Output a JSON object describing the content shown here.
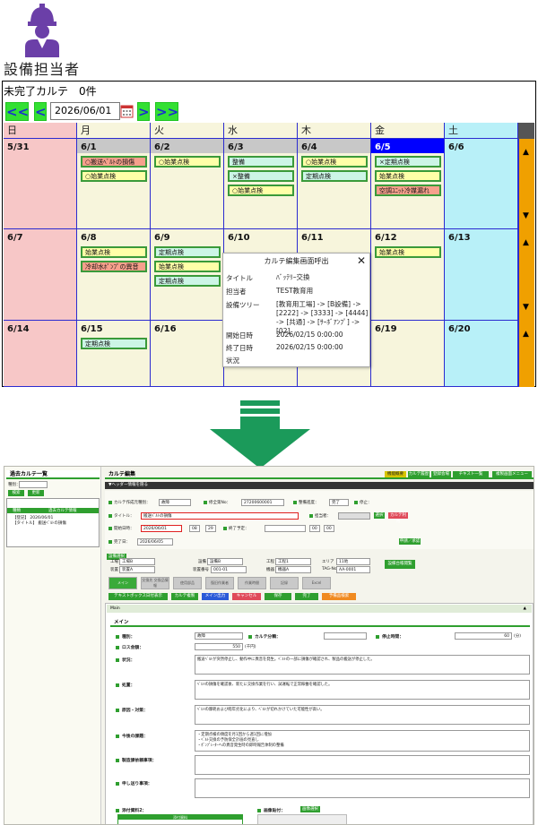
{
  "role": {
    "label": "設備担当者"
  },
  "calendar": {
    "title": "未完了カルテ　0件",
    "nav": {
      "first": "<<",
      "prev": "<",
      "next": ">",
      "last": ">>"
    },
    "date_value": "2026/06/01",
    "weekdays": [
      "日",
      "月",
      "火",
      "水",
      "木",
      "金",
      "土"
    ],
    "weeks": [
      {
        "days": [
          {
            "num": "5/31",
            "chips": []
          },
          {
            "num": "6/1",
            "chips": [
              {
                "text": "○搬送ﾍﾞﾙﾄの損傷",
                "kind": "r"
              },
              {
                "text": "○始業点検",
                "kind": "y"
              }
            ]
          },
          {
            "num": "6/2",
            "chips": [
              {
                "text": "○始業点検",
                "kind": "y"
              }
            ]
          },
          {
            "num": "6/3",
            "chips": [
              {
                "text": "整備",
                "kind": "c"
              },
              {
                "text": "×整備",
                "kind": "c"
              },
              {
                "text": "○始業点検",
                "kind": "y"
              }
            ]
          },
          {
            "num": "6/4",
            "chips": [
              {
                "text": "○始業点検",
                "kind": "y"
              },
              {
                "text": "定期点検",
                "kind": "c"
              }
            ]
          },
          {
            "num": "6/5",
            "chips": [
              {
                "text": "×定期点検",
                "kind": "c"
              },
              {
                "text": "始業点検",
                "kind": "y"
              },
              {
                "text": "空調ﾕﾆｯﾄ冷媒漏れ",
                "kind": "r"
              }
            ]
          },
          {
            "num": "6/6",
            "chips": []
          }
        ]
      },
      {
        "days": [
          {
            "num": "6/7",
            "chips": []
          },
          {
            "num": "6/8",
            "chips": [
              {
                "text": "始業点検",
                "kind": "y"
              },
              {
                "text": "冷却水ﾎﾟﾝﾌﾟの異音",
                "kind": "r"
              }
            ]
          },
          {
            "num": "6/9",
            "chips": [
              {
                "text": "定期点検",
                "kind": "c"
              },
              {
                "text": "始業点検",
                "kind": "y"
              },
              {
                "text": "定期点検",
                "kind": "c"
              }
            ]
          },
          {
            "num": "6/10",
            "chips": []
          },
          {
            "num": "6/11",
            "chips": []
          },
          {
            "num": "6/12",
            "chips": [
              {
                "text": "始業点検",
                "kind": "y"
              }
            ]
          },
          {
            "num": "6/13",
            "chips": []
          }
        ]
      },
      {
        "days": [
          {
            "num": "6/14",
            "chips": []
          },
          {
            "num": "6/15",
            "chips": [
              {
                "text": "定期点検",
                "kind": "c"
              }
            ]
          },
          {
            "num": "6/16",
            "chips": []
          },
          {
            "num": "",
            "chips": []
          },
          {
            "num": "",
            "chips": []
          },
          {
            "num": "6/19",
            "chips": []
          },
          {
            "num": "6/20",
            "chips": []
          }
        ]
      }
    ],
    "today_index": 5,
    "scroll": {
      "up": "▲",
      "down": "▼"
    }
  },
  "popup": {
    "title": "カルテ編集画面呼出",
    "close": "✕",
    "rows": [
      {
        "key": "タイトル",
        "value": "ﾊﾞｯﾃﾘｰ交換"
      },
      {
        "key": "担当者",
        "value": "TEST教育用"
      },
      {
        "key": "設備ツリー",
        "value": "[教育用工場] -> [B設備] -> [2222] -> [3333] -> [4444] -> [共通] -> [ｻｰﾎﾞｱﾝﾌﾟ] -> [02]"
      },
      {
        "key": "開始日時",
        "value": "2026/02/15 0:00:00"
      },
      {
        "key": "終了日時",
        "value": "2026/02/15 0:00:00"
      },
      {
        "key": "状況",
        "value": ""
      }
    ]
  },
  "editor": {
    "left_title": "過去カルテ一覧",
    "left_kind_label": "種別：",
    "left_btn1": "検索",
    "left_btn2": "更新",
    "left_col1": "種類",
    "left_col2": "過去カルテ情報",
    "left_row1": "【登記】 2026/06/01",
    "left_row2": "【タイトル】 搬送ﾍﾞﾙﾄの損傷",
    "title": "カルテ編集",
    "top_btns": [
      "機能概要",
      "カルテ履歴",
      "登録会場",
      "チキスト一覧",
      "複製画面メニュー"
    ],
    "header_toggle": "▼ヘッダー情報を隠る",
    "f_created_label": "カルテ作成元種別：",
    "f_created": "故障",
    "f_no_label": "修全第No：",
    "f_no": "27200600001",
    "f_status_label": "整備進度：",
    "f_status": "完了",
    "f_stop_label": "停止：",
    "f_title_label": "タイトル：",
    "f_title": "搬送ﾍﾞﾙﾄの損傷",
    "f_person_label": "担当者：",
    "f_select": "選択",
    "f_rec": "カルテ利用",
    "f_start_label": "開始日時：",
    "f_start_date": "2026/06/01",
    "f_start_h": "08",
    "f_start_m": "29",
    "f_end_label": "終了予定：",
    "f_end_h": "00",
    "f_end_m": "00",
    "f_done_label": "完了日：",
    "f_done": "2026/06/05",
    "f_apply": "申請／承認",
    "equip_label": "設備選択",
    "eq_factory_l": "工場",
    "eq_factory": "工場B",
    "eq_equip_l": "設備",
    "eq_equip": "設備B",
    "eq_proc_l": "工程",
    "eq_proc": "工程1",
    "eq_area_l": "エリア",
    "eq_area": "11地",
    "eq_dev_l": "装置",
    "eq_dev": "装置A",
    "eq_devno_l": "装置番号",
    "eq_devno": "001-01",
    "eq_machine_l": "機器",
    "eq_machine": "機器A",
    "eq_tag_l": "TAG-No",
    "eq_tag": "AA-0001",
    "eq_btn": "設備台帳閲覧",
    "big_btns": [
      "メイン",
      "交換先\n交換品情報",
      "使用部品",
      "復旧作業者",
      "作業時間",
      "記録",
      "Excel"
    ],
    "tool_btns": [
      "テキストボックス日付表示",
      "カルテ複製",
      "メイン出力",
      "キャンセル",
      "保存",
      "完了",
      "予備品検索"
    ],
    "main_label": "Main",
    "main_title": "メイン",
    "m_kind_label": "種別：",
    "m_kind": "故障",
    "m_class_label": "カルテ分類：",
    "m_stop_label": "停止時間：",
    "m_stop": "60",
    "m_stop_unit": "(分)",
    "m_loss_label": "ロス金額：",
    "m_loss": "550",
    "m_loss_unit": "(千円)",
    "a_state_label": "状況：",
    "a_state": "搬送ﾍﾞﾙﾄが突然停止し、動作中に異音を発生。ﾍﾞﾙﾄの一部に損傷が確認され、製品の搬送が停止した。",
    "a_action_label": "処置：",
    "a_action": "ﾍﾞﾙﾄの損傷を確認後、新たに交換作業を行い、試運転で正常稼働を確認した。",
    "a_cause_label": "原因・対策：",
    "a_cause": "ﾍﾞﾙﾄの摩耗および経年劣化により、ﾍﾞﾙﾄが切れかけていた可能性が高い。",
    "a_future_label": "今後の課題：",
    "a_future": "・定期点検の頻度を月1回から週1回に増加\n・ﾍﾞﾙﾄ交換の予防保全計画の見直し\n・ﾎﾟﾝﾌﾟﾚｰﾀｰへの異音発生時の即時報告体制の整備",
    "a_maker_label": "製造課依頼事項：",
    "a_memo_label": "申し送り事項：",
    "attach_label": "添付資料2：",
    "attach_head": "添付資料",
    "img_label": "画像貼付：",
    "img_btn": "画像選択"
  },
  "colors": {
    "sun": "#f7c7c7",
    "sat": "#b8f0f8",
    "week": "#f7f5dc",
    "popup_bg": "#ffffff",
    "nav": "#33e033"
  }
}
